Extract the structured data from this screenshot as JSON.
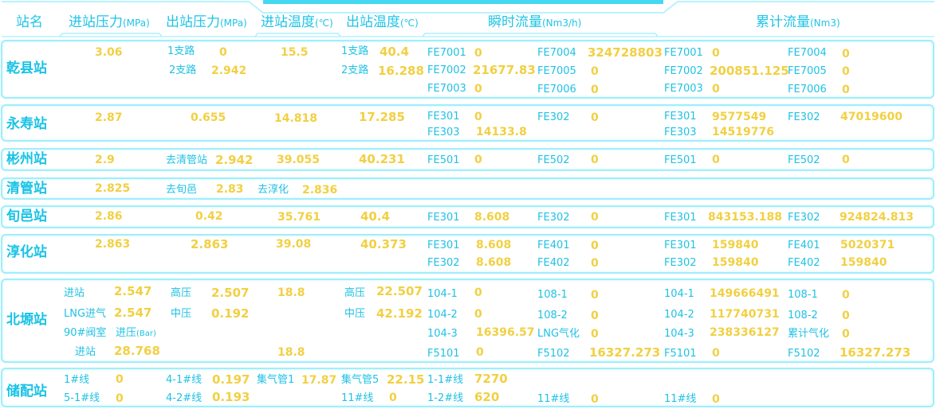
{
  "headers": {
    "station": "站名",
    "in_pressure": "进站压力",
    "in_pressure_unit": "(MPa)",
    "out_pressure": "出站压力",
    "out_pressure_unit": "(MPa)",
    "in_temp": "进站温度",
    "in_temp_unit": "(℃)",
    "out_temp": "出站温度",
    "out_temp_unit": "(℃)",
    "inst_flow": "瞬时流量",
    "inst_flow_unit": "(Nm3/h)",
    "cum_flow": "累计流量",
    "cum_flow_unit": "(Nm3)"
  },
  "qianxian": {
    "name": "乾县站",
    "in_pressure": "3.06",
    "out1_label": "1支路",
    "out1_value": "0",
    "out2_label": "2支路",
    "out2_value": "2.942",
    "in_temp": "15.5",
    "t1_label": "1支路",
    "t1_value": "40.4",
    "t2_label": "2支路",
    "t2_value": "16.288",
    "inst": [
      {
        "label": "FE7001",
        "value": "0"
      },
      {
        "label": "FE7004",
        "value": "324728803"
      },
      {
        "label": "FE7002",
        "value": "21677.83"
      },
      {
        "label": "FE7005",
        "value": "0"
      },
      {
        "label": "FE7003",
        "value": "0"
      },
      {
        "label": "FE7006",
        "value": "0"
      }
    ],
    "cum": [
      {
        "label": "FE7001",
        "value": "0"
      },
      {
        "label": "FE7004",
        "value": "0"
      },
      {
        "label": "FE7002",
        "value": "200851.125"
      },
      {
        "label": "FE7005",
        "value": "0"
      },
      {
        "label": "FE7003",
        "value": "0"
      },
      {
        "label": "FE7006",
        "value": "0"
      }
    ]
  },
  "yongshou": {
    "name": "永寿站",
    "in_pressure": "2.87",
    "out_pressure": "0.655",
    "in_temp": "14.818",
    "out_temp": "17.285",
    "inst": [
      {
        "label": "FE301",
        "value": "0"
      },
      {
        "label": "FE302",
        "value": "0"
      },
      {
        "label": "FE303",
        "value": "14133.8"
      }
    ],
    "cum": [
      {
        "label": "FE301",
        "value": "9577549"
      },
      {
        "label": "FE302",
        "value": "47019600"
      },
      {
        "label": "FE303",
        "value": "14519776"
      }
    ]
  },
  "binzhou": {
    "name": "彬州站",
    "in_pressure": "2.9",
    "out_label": "去清管站",
    "out_value": "2.942",
    "in_temp": "39.055",
    "out_temp": "40.231",
    "inst": [
      {
        "label": "FE501",
        "value": "0"
      },
      {
        "label": "FE502",
        "value": "0"
      }
    ],
    "cum": [
      {
        "label": "FE501",
        "value": "0"
      },
      {
        "label": "FE502",
        "value": "0"
      }
    ]
  },
  "qingguan": {
    "name": "清管站",
    "in_pressure": "2.825",
    "out_label": "去旬邑",
    "out_value": "2.83",
    "extra_label": "去淳化",
    "extra_value": "2.836"
  },
  "xunyi": {
    "name": "旬邑站",
    "in_pressure": "2.86",
    "out_pressure": "0.42",
    "in_temp": "35.761",
    "out_temp": "40.4",
    "inst": [
      {
        "label": "FE301",
        "value": "8.608"
      },
      {
        "label": "FE302",
        "value": "0"
      }
    ],
    "cum": [
      {
        "label": "FE301",
        "value": "843153.188"
      },
      {
        "label": "FE302",
        "value": "924824.813"
      }
    ]
  },
  "chunhua": {
    "name": "淳化站",
    "in_pressure": "2.863",
    "out_pressure": "2.863",
    "in_temp": "39.08",
    "out_temp": "40.373",
    "inst": [
      {
        "label": "FE301",
        "value": "8.608"
      },
      {
        "label": "FE401",
        "value": "0"
      },
      {
        "label": "FE302",
        "value": "8.608"
      },
      {
        "label": "FE402",
        "value": "0"
      }
    ],
    "cum": [
      {
        "label": "FE301",
        "value": "159840"
      },
      {
        "label": "FE401",
        "value": "5020371"
      },
      {
        "label": "FE302",
        "value": "159840"
      },
      {
        "label": "FE402",
        "value": "159840"
      }
    ]
  },
  "beiyuan": {
    "name": "北塬站",
    "in1_label": "进站",
    "in1_value": "2.547",
    "in2_label": "LNG进气",
    "in2_value": "2.547",
    "in3_label": "90#阀室",
    "in3_sub": "进压",
    "in3_unit": "(Bar)",
    "in4_label": "进站",
    "in4_value": "28.768",
    "out1_label": "高压",
    "out1_value": "2.507",
    "out2_label": "中压",
    "out2_value": "0.192",
    "in_temp1": "18.8",
    "in_temp2": "18.8",
    "t1_label": "高压",
    "t1_value": "22.507",
    "t2_label": "中压",
    "t2_value": "42.192",
    "inst": [
      {
        "label": "104-1",
        "value": "0"
      },
      {
        "label": "108-1",
        "value": "0"
      },
      {
        "label": "104-2",
        "value": "0"
      },
      {
        "label": "108-2",
        "value": "0"
      },
      {
        "label": "104-3",
        "value": "16396.57"
      },
      {
        "label": "LNG气化",
        "value": "0"
      },
      {
        "label": "F5101",
        "value": "0"
      },
      {
        "label": "F5102",
        "value": "16327.273"
      }
    ],
    "cum": [
      {
        "label": "104-1",
        "value": "149666491"
      },
      {
        "label": "108-1",
        "value": "0"
      },
      {
        "label": "104-2",
        "value": "117740731"
      },
      {
        "label": "108-2",
        "value": "0"
      },
      {
        "label": "104-3",
        "value": "238336127"
      },
      {
        "label": "累计气化",
        "value": "0"
      },
      {
        "label": "F5101",
        "value": "0"
      },
      {
        "label": "F5102",
        "value": "16327.273"
      }
    ]
  },
  "chupei": {
    "name": "储配站",
    "a1_label": "1#线",
    "a1_value": "0",
    "a2_label": "5-1#线",
    "a2_value": "0",
    "b1_label": "4-1#线",
    "b1_value": "0.197",
    "b2_label": "4-2#线",
    "b2_value": "0.193",
    "c1_label": "集气管1",
    "c1_value": "17.87",
    "d1_label": "集气管5",
    "d1_value": "22.15",
    "d2_label": "11#线",
    "d2_value": "0",
    "inst": [
      {
        "label": "1-1#线",
        "value": "7270"
      },
      {
        "label": "1-2#线",
        "value": "620"
      },
      {
        "label": "11#线",
        "value": "0"
      }
    ],
    "cum": [
      {
        "label": "11#线",
        "value": "0"
      }
    ]
  }
}
